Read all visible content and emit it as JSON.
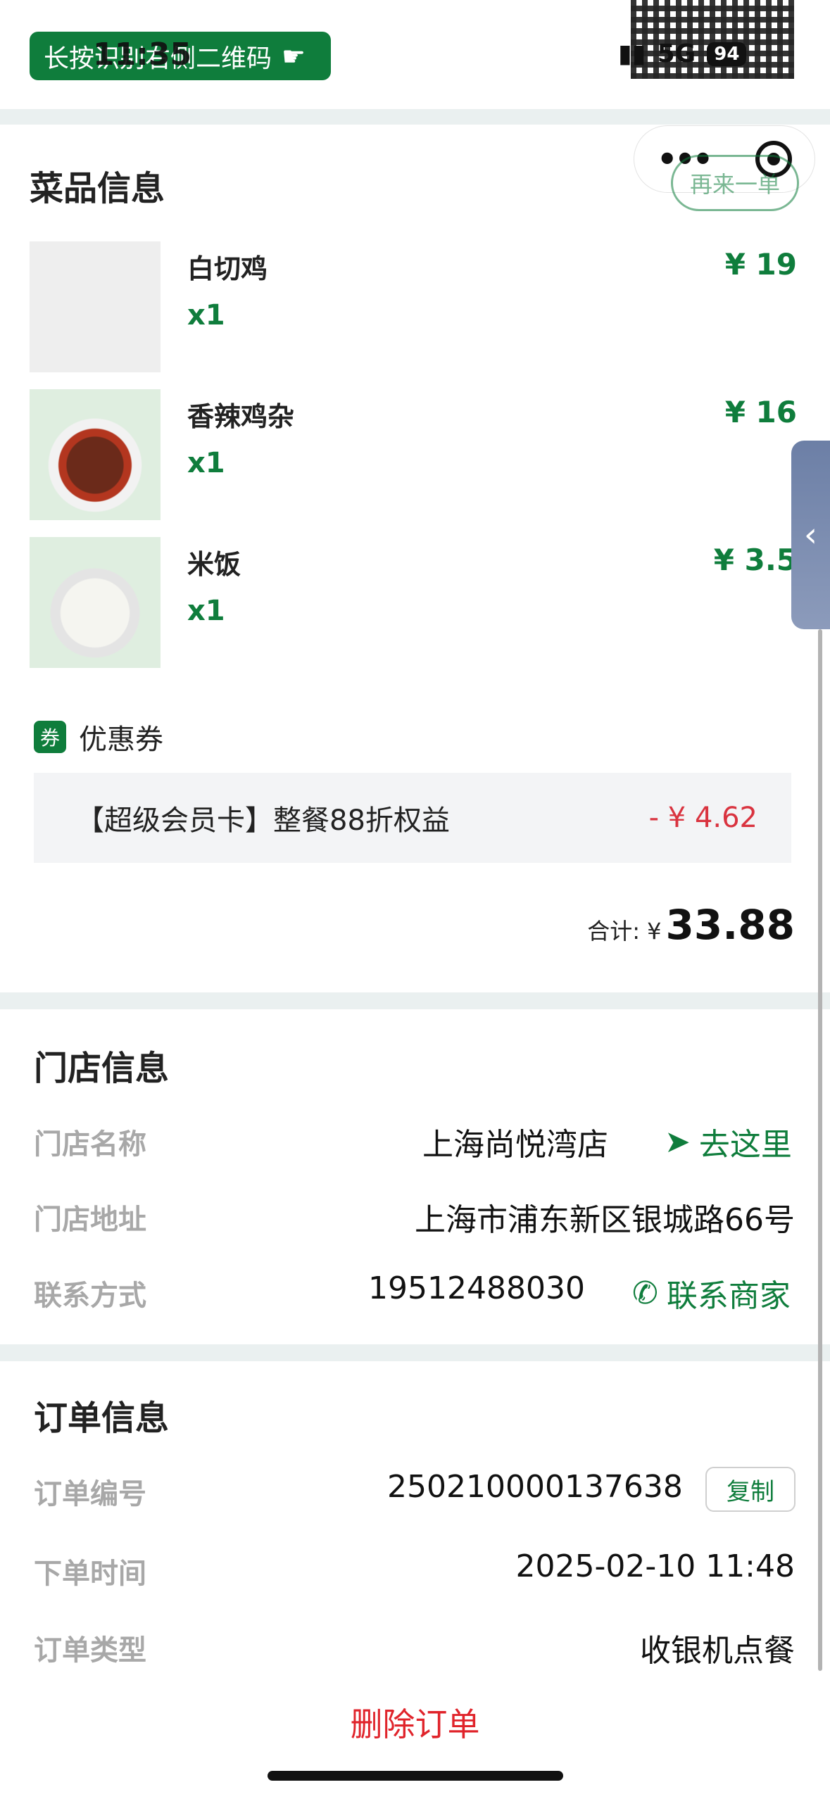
{
  "status_bar": {
    "time": "11:35",
    "network": "5G",
    "battery": "94"
  },
  "header": {
    "qr_banner": "长按识别右侧二维码"
  },
  "dishes": {
    "title": "菜品信息",
    "again_button": "再来一单",
    "items": [
      {
        "name": "白切鸡",
        "qty": "x1",
        "price": "¥ 19"
      },
      {
        "name": "香辣鸡杂",
        "qty": "x1",
        "price": "¥ 16"
      },
      {
        "name": "米饭",
        "qty": "x1",
        "price": "¥ 3.5"
      }
    ],
    "coupon_badge": "券",
    "coupon_title": "优惠券",
    "coupon_name": "【超级会员卡】整餐88折权益",
    "coupon_discount": "- ¥ 4.62",
    "total_label": "合计: ¥",
    "total_value": "33.88"
  },
  "store": {
    "title": "门店信息",
    "name_label": "门店名称",
    "name": "上海尚悦湾店",
    "go_label": "去这里",
    "address_label": "门店地址",
    "address": "上海市浦东新区银城路66号",
    "contact_label": "联系方式",
    "phone": "19512488030",
    "contact_link": "联系商家"
  },
  "order": {
    "title": "订单信息",
    "number_label": "订单编号",
    "number": "250210000137638",
    "copy_label": "复制",
    "time_label": "下单时间",
    "time": "2025-02-10 11:48",
    "type_label": "订单类型",
    "type": "收银机点餐",
    "delete_label": "删除订单"
  },
  "colors": {
    "accent": "#0f7d3c",
    "danger": "#e0242b",
    "discount": "#d9333f"
  }
}
